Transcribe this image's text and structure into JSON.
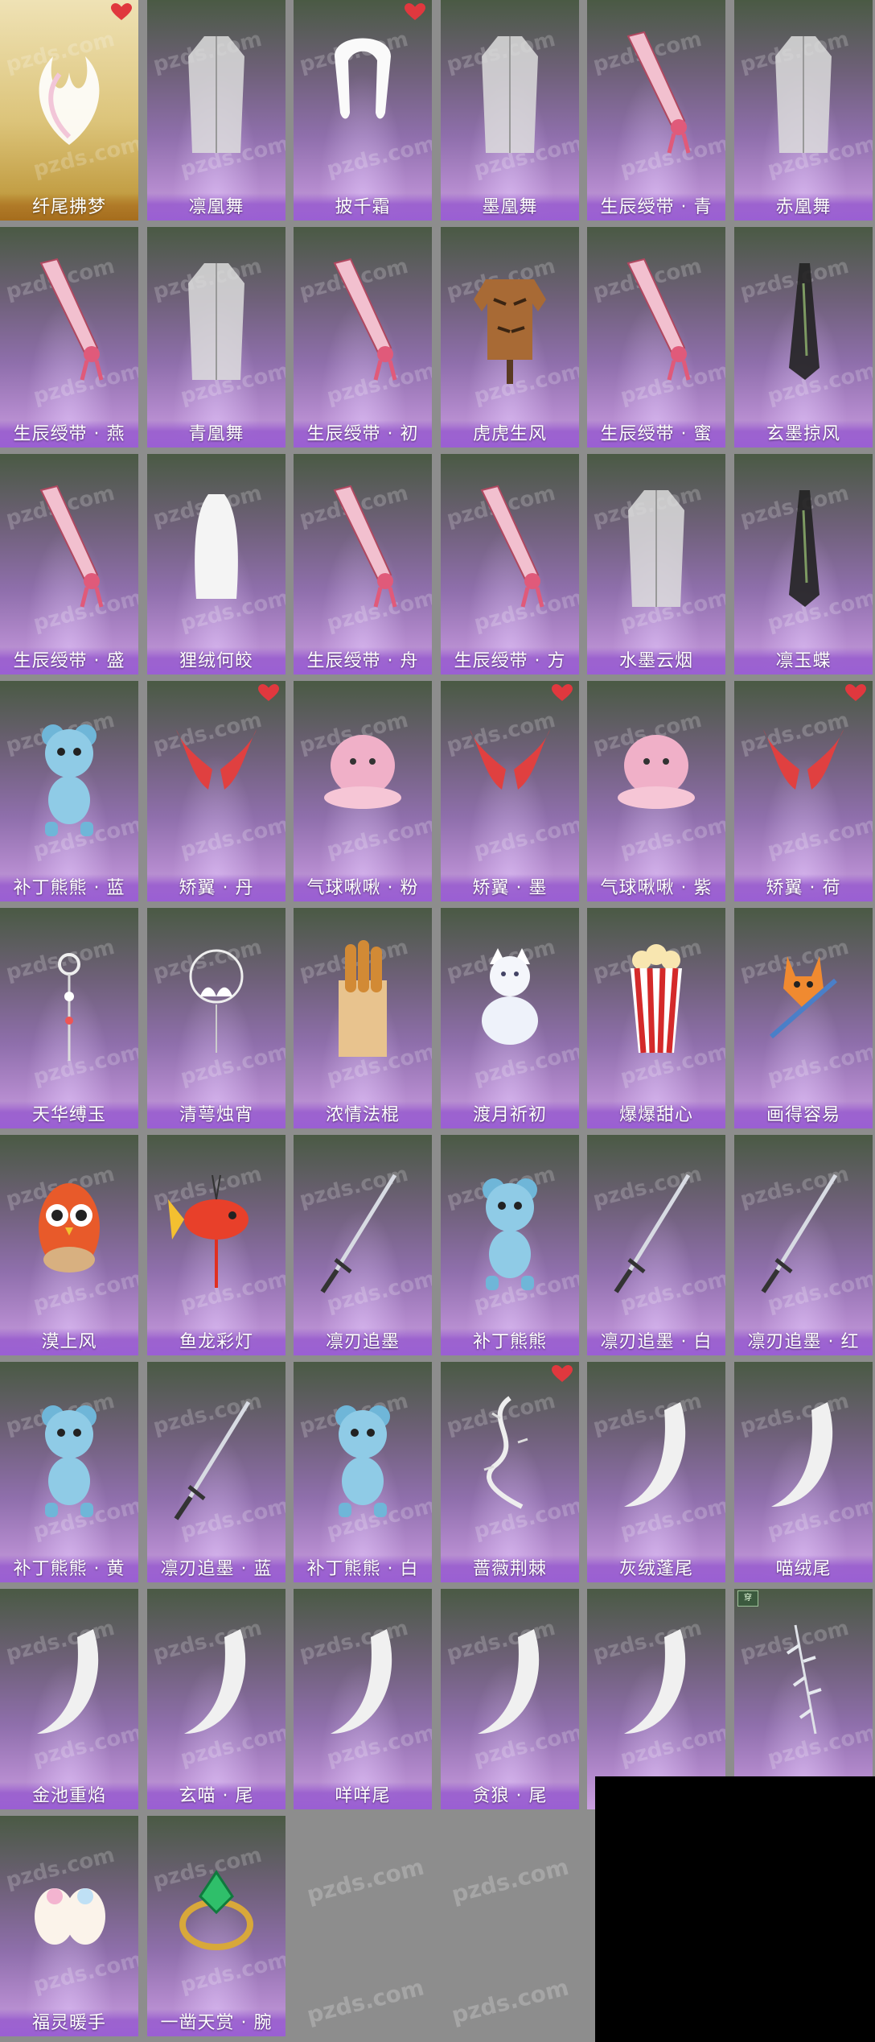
{
  "watermark": "pzds.com",
  "colors": {
    "label_band": "#9a5fd3",
    "featured_band": "#a56d1d",
    "heart": "#e0383e",
    "page_background": "#8d8d8d"
  },
  "items": [
    {
      "name": "纤尾拂梦",
      "favorite": true,
      "featured": true,
      "icon": "fox-tail-icon"
    },
    {
      "name": "凛凰舞",
      "favorite": false,
      "featured": false,
      "icon": "robe-icon"
    },
    {
      "name": "披千霜",
      "favorite": true,
      "featured": false,
      "icon": "fur-stole-icon"
    },
    {
      "name": "墨凰舞",
      "favorite": false,
      "featured": false,
      "icon": "robe-icon"
    },
    {
      "name": "生辰绶带 · 青",
      "favorite": false,
      "featured": false,
      "icon": "sash-icon"
    },
    {
      "name": "赤凰舞",
      "favorite": false,
      "featured": false,
      "icon": "robe-icon"
    },
    {
      "name": "生辰绶带 · 燕",
      "favorite": false,
      "featured": false,
      "icon": "sash-icon"
    },
    {
      "name": "青凰舞",
      "favorite": false,
      "featured": false,
      "icon": "robe-icon"
    },
    {
      "name": "生辰绶带 · 初",
      "favorite": false,
      "featured": false,
      "icon": "sash-icon"
    },
    {
      "name": "虎虎生风",
      "favorite": false,
      "featured": false,
      "icon": "tiger-coat-icon"
    },
    {
      "name": "生辰绶带 · 蜜",
      "favorite": false,
      "featured": false,
      "icon": "sash-icon"
    },
    {
      "name": "玄墨掠风",
      "favorite": false,
      "featured": false,
      "icon": "cape-icon"
    },
    {
      "name": "生辰绶带 · 盛",
      "favorite": false,
      "featured": false,
      "icon": "sash-icon"
    },
    {
      "name": "狸绒何皎",
      "favorite": false,
      "featured": false,
      "icon": "fur-cape-icon"
    },
    {
      "name": "生辰绶带 · 舟",
      "favorite": false,
      "featured": false,
      "icon": "sash-icon"
    },
    {
      "name": "生辰绶带 · 方",
      "favorite": false,
      "featured": false,
      "icon": "sash-icon"
    },
    {
      "name": "水墨云烟",
      "favorite": false,
      "featured": false,
      "icon": "robe-icon"
    },
    {
      "name": "凛玉蝶",
      "favorite": false,
      "featured": false,
      "icon": "cape-icon"
    },
    {
      "name": "补丁熊熊 · 蓝",
      "favorite": false,
      "featured": false,
      "icon": "teddy-bear-icon"
    },
    {
      "name": "矫翼 · 丹",
      "favorite": true,
      "featured": false,
      "icon": "wings-icon"
    },
    {
      "name": "气球啾啾 · 粉",
      "favorite": false,
      "featured": false,
      "icon": "balloon-pet-icon"
    },
    {
      "name": "矫翼 · 墨",
      "favorite": true,
      "featured": false,
      "icon": "wings-icon"
    },
    {
      "name": "气球啾啾 · 紫",
      "favorite": false,
      "featured": false,
      "icon": "balloon-pet-icon"
    },
    {
      "name": "矫翼 · 荷",
      "favorite": true,
      "featured": false,
      "icon": "wings-icon"
    },
    {
      "name": "天华缚玉",
      "favorite": false,
      "featured": false,
      "icon": "pendant-icon"
    },
    {
      "name": "清萼烛宵",
      "favorite": false,
      "featured": false,
      "icon": "lotus-lamp-icon"
    },
    {
      "name": "浓情法棍",
      "favorite": false,
      "featured": false,
      "icon": "baguette-icon"
    },
    {
      "name": "渡月祈初",
      "favorite": false,
      "featured": false,
      "icon": "cat-icon"
    },
    {
      "name": "爆爆甜心",
      "favorite": false,
      "featured": false,
      "icon": "popcorn-icon"
    },
    {
      "name": "画得容易",
      "favorite": false,
      "featured": false,
      "icon": "fox-brush-icon"
    },
    {
      "name": "漠上风",
      "favorite": false,
      "featured": false,
      "icon": "owl-icon"
    },
    {
      "name": "鱼龙彩灯",
      "favorite": false,
      "featured": false,
      "icon": "fish-lantern-icon"
    },
    {
      "name": "凛刃追墨",
      "favorite": false,
      "featured": false,
      "icon": "sword-icon"
    },
    {
      "name": "补丁熊熊",
      "favorite": false,
      "featured": false,
      "icon": "teddy-bear-icon"
    },
    {
      "name": "凛刃追墨 · 白",
      "favorite": false,
      "featured": false,
      "icon": "sword-icon"
    },
    {
      "name": "凛刃追墨 · 红",
      "favorite": false,
      "featured": false,
      "icon": "sword-icon"
    },
    {
      "name": "补丁熊熊 · 黄",
      "favorite": false,
      "featured": false,
      "icon": "teddy-bear-icon"
    },
    {
      "name": "凛刃追墨 · 蓝",
      "favorite": false,
      "featured": false,
      "icon": "sword-icon"
    },
    {
      "name": "补丁熊熊 · 白",
      "favorite": false,
      "featured": false,
      "icon": "teddy-bear-icon"
    },
    {
      "name": "蔷薇荆棘",
      "favorite": true,
      "featured": false,
      "icon": "thorn-vine-icon"
    },
    {
      "name": "灰绒蓬尾",
      "favorite": false,
      "featured": false,
      "icon": "tail-icon"
    },
    {
      "name": "喵绒尾",
      "favorite": false,
      "featured": false,
      "icon": "tail-icon"
    },
    {
      "name": "金池重焰",
      "favorite": false,
      "featured": false,
      "icon": "tail-icon"
    },
    {
      "name": "玄喵 · 尾",
      "favorite": false,
      "featured": false,
      "icon": "tail-icon"
    },
    {
      "name": "咩咩尾",
      "favorite": false,
      "featured": false,
      "icon": "tail-icon"
    },
    {
      "name": "贪狼 · 尾",
      "favorite": false,
      "featured": false,
      "icon": "tail-icon"
    },
    {
      "name": "",
      "favorite": false,
      "featured": false,
      "icon": "tail-icon"
    },
    {
      "name": "",
      "favorite": false,
      "featured": false,
      "icon": "feather-icon",
      "tag": "穿"
    },
    {
      "name": "福灵暖手",
      "favorite": false,
      "featured": false,
      "icon": "mittens-icon"
    },
    {
      "name": "一凿天赏 · 腕",
      "favorite": false,
      "featured": false,
      "icon": "jade-bracelet-icon"
    }
  ]
}
